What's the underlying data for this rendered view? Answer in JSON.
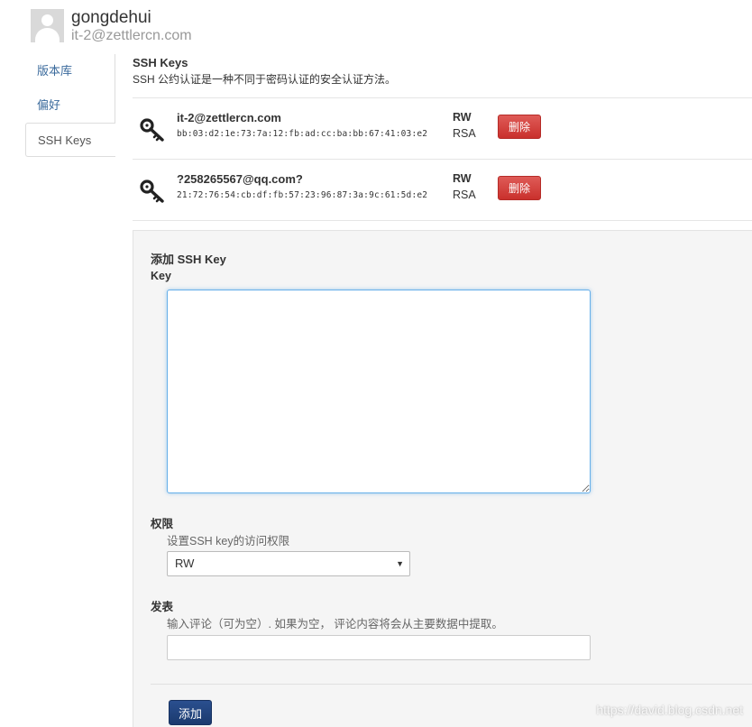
{
  "user": {
    "name": "gongdehui",
    "email": "it-2@zettlercn.com"
  },
  "sidebar": {
    "items": [
      {
        "label": "版本库"
      },
      {
        "label": "偏好"
      },
      {
        "label": "SSH Keys"
      }
    ]
  },
  "ssh": {
    "title": "SSH Keys",
    "description": "SSH 公约认证是一种不同于密码认证的安全认证方法。"
  },
  "keys": [
    {
      "title": "it-2@zettlercn.com",
      "fingerprint": "bb:03:d2:1e:73:7a:12:fb:ad:cc:ba:bb:67:41:03:e2",
      "perm": "RW",
      "type": "RSA",
      "delete_label": "删除"
    },
    {
      "title": "?258265567@qq.com?",
      "fingerprint": "21:72:76:54:cb:df:fb:57:23:96:87:3a:9c:61:5d:e2",
      "perm": "RW",
      "type": "RSA",
      "delete_label": "删除"
    }
  ],
  "add_form": {
    "title": "添加 SSH Key",
    "key_label": "Key",
    "key_value": "",
    "perm_label": "权限",
    "perm_help": "设置SSH key的访问权限",
    "perm_value": "RW",
    "pub_label": "发表",
    "pub_help": "输入评论（可为空）. 如果为空， 评论内容将会从主要数据中提取。",
    "pub_value": "",
    "submit_label": "添加"
  },
  "watermark": "https://david.blog.csdn.net",
  "colors": {
    "danger": "#d9534f",
    "primary": "#1f3f78",
    "link": "#3a6a9c",
    "focus_border": "#66afe9"
  }
}
